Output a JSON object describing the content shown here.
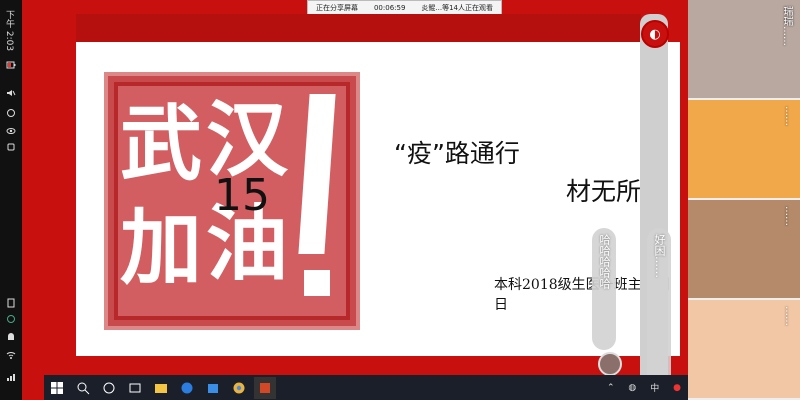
{
  "status_bar": {
    "time": "下午 2:03"
  },
  "share_bar": {
    "sharing_label": "正在分享屏幕",
    "duration": "00:06:59",
    "viewers": "炎鲲...等14人正在观看"
  },
  "slide": {
    "stamp_chars": [
      "武",
      "汉",
      "加",
      "油"
    ],
    "page_number": "15",
    "title_line1": "“疫”路通行",
    "title_line2": "材无所惧",
    "subtitle": "本科2018级生医一班主题团日"
  },
  "danmaku": [
    "哈哈哈哈哈",
    "好困……",
    "……"
  ],
  "cams": [
    {
      "label": "瑞瑞……",
      "bg": "#b9a8a0"
    },
    {
      "label": "……",
      "bg": "#f0a84a"
    },
    {
      "label": "……",
      "bg": "#b48a6a"
    },
    {
      "label": "……",
      "bg": "#f2c7a6"
    }
  ],
  "colors": {
    "brand_red": "#c8100e",
    "stamp_red": "#b7282a"
  }
}
